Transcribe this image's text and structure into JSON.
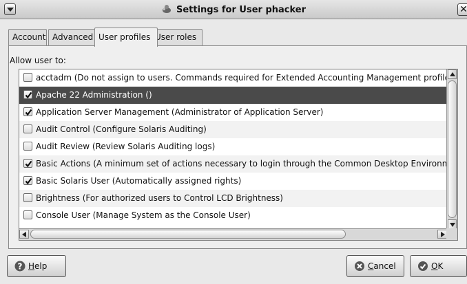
{
  "window": {
    "title": "Settings for User phacker",
    "close_glyph": "✕"
  },
  "tabs": [
    {
      "label": "Account",
      "active": false
    },
    {
      "label": "Advanced",
      "active": false
    },
    {
      "label": "User profiles",
      "active": true
    },
    {
      "label": "User roles",
      "active": false
    }
  ],
  "section": {
    "label": "Allow user to:"
  },
  "profiles": [
    {
      "label": "acctadm (Do not assign to users. Commands required for Extended Accounting Management profiles)",
      "checked": false,
      "selected": false
    },
    {
      "label": "Apache 22 Administration ()",
      "checked": true,
      "selected": true
    },
    {
      "label": "Application Server Management (Administrator of Application Server)",
      "checked": true,
      "selected": false
    },
    {
      "label": "Audit Control (Configure Solaris Auditing)",
      "checked": false,
      "selected": false
    },
    {
      "label": "Audit Review (Review Solaris Auditing logs)",
      "checked": false,
      "selected": false
    },
    {
      "label": "Basic Actions (A minimum set of actions necessary to login through the Common Desktop Environment",
      "checked": true,
      "selected": false
    },
    {
      "label": "Basic Solaris User (Automatically assigned rights)",
      "checked": true,
      "selected": false
    },
    {
      "label": "Brightness (For authorized users to Control LCD Brightness)",
      "checked": false,
      "selected": false
    },
    {
      "label": "Console User (Manage System as the Console User)",
      "checked": false,
      "selected": false
    }
  ],
  "buttons": {
    "help": {
      "mnemonic": "H",
      "rest": "elp"
    },
    "cancel": {
      "mnemonic": "C",
      "rest": "ancel"
    },
    "ok": {
      "mnemonic": "O",
      "rest": "K"
    }
  },
  "colors": {
    "selected_row": "#4a4a4a",
    "window_bg": "#e9e9e9"
  }
}
